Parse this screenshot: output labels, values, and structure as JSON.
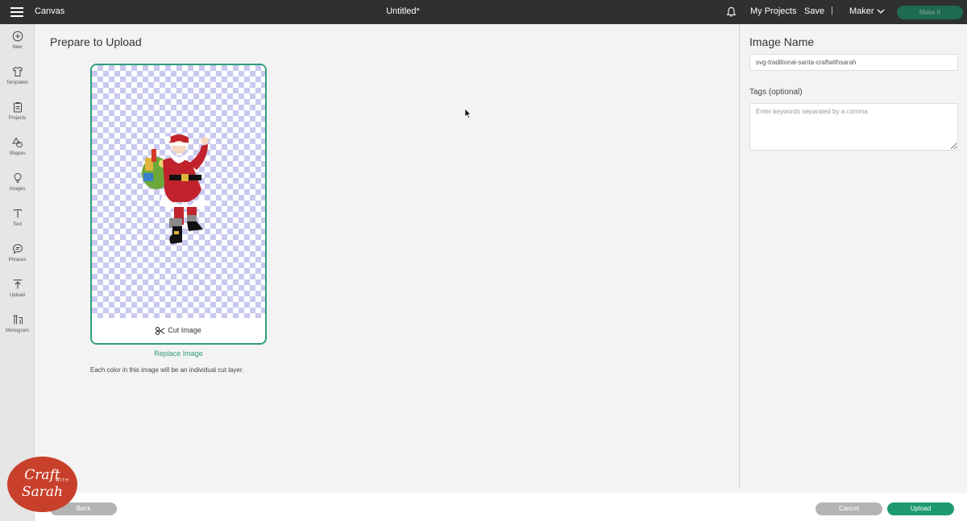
{
  "topbar": {
    "app_name": "Canvas",
    "doc_title": "Untitled*",
    "my_projects": "My Projects",
    "save": "Save",
    "separator": "|",
    "machine": "Maker",
    "make_it": "Make It"
  },
  "sidebar": {
    "items": [
      {
        "label": "New",
        "icon": "plus-circle-icon"
      },
      {
        "label": "Templates",
        "icon": "shirt-icon"
      },
      {
        "label": "Projects",
        "icon": "clipboard-icon"
      },
      {
        "label": "Shapes",
        "icon": "shapes-icon"
      },
      {
        "label": "Images",
        "icon": "lightbulb-icon"
      },
      {
        "label": "Text",
        "icon": "text-icon"
      },
      {
        "label": "Phrases",
        "icon": "speech-bubble-icon"
      },
      {
        "label": "Upload",
        "icon": "upload-icon"
      },
      {
        "label": "Monogram",
        "icon": "monogram-icon"
      }
    ]
  },
  "main": {
    "title": "Prepare to Upload",
    "cut_image_label": "Cut Image",
    "replace_image": "Replace Image",
    "note": "Each color in this image will be an individual cut layer."
  },
  "panel": {
    "title": "Image Name",
    "image_name_value": "svg-traditional-santa-craftwithsarah",
    "tags_label": "Tags (optional)",
    "tags_placeholder": "Enter keywords separated by a comma"
  },
  "footer": {
    "back": "Back",
    "cancel": "Cancel",
    "upload": "Upload"
  },
  "logo": {
    "line1": "Craft",
    "with": "WITH",
    "line2": "Sarah"
  },
  "colors": {
    "accent": "#2f9e7b",
    "topbar": "#2e3032",
    "upload_button": "#1e9a72",
    "logo": "#c8402b"
  }
}
